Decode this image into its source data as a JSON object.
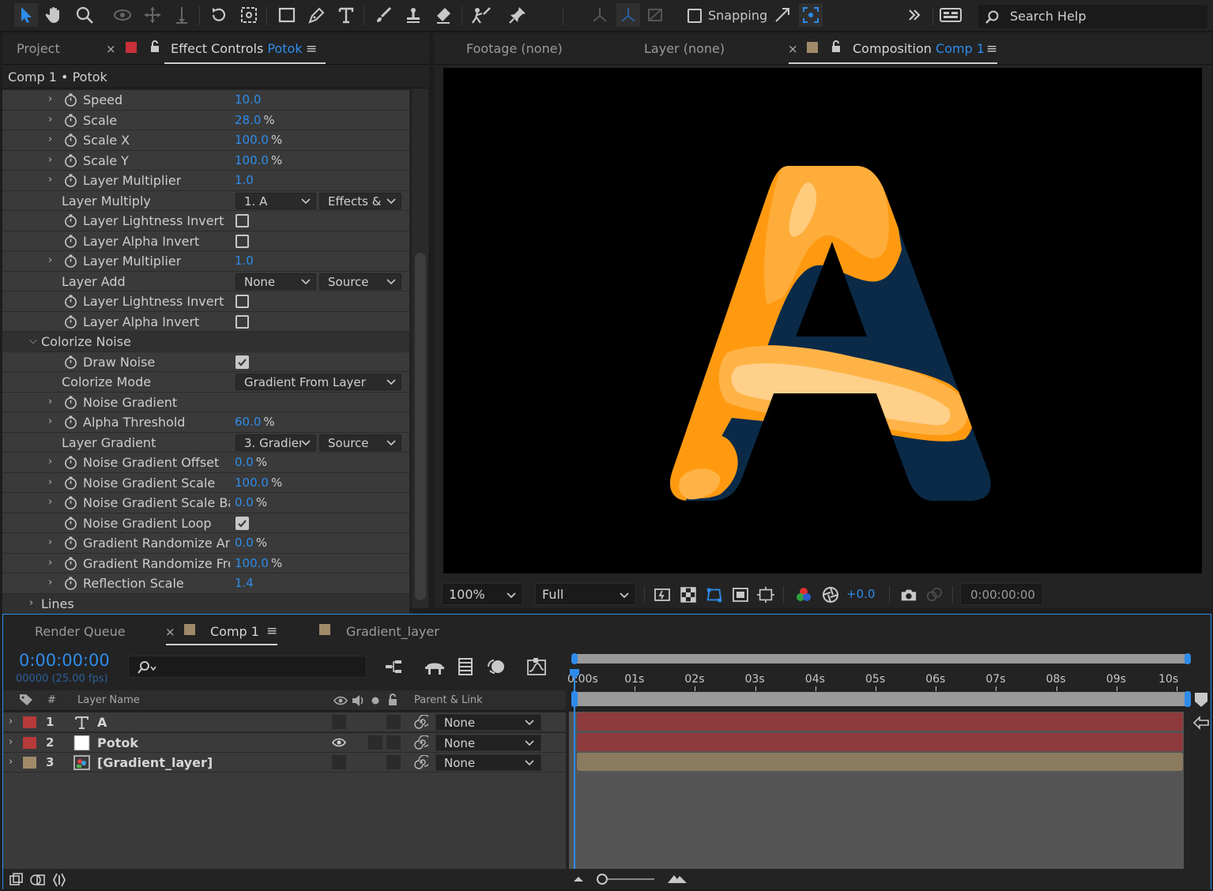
{
  "toolbar": {
    "snapping_label": "Snapping",
    "search_placeholder": "Search Help"
  },
  "left_panel": {
    "tabs": [
      {
        "label": "Project"
      },
      {
        "label": "Effect Controls",
        "target": "Potok"
      }
    ],
    "header": "Comp 1 • Potok",
    "rows": [
      {
        "name": "Speed",
        "value": "10.0",
        "unit": ""
      },
      {
        "name": "Scale",
        "value": "28.0",
        "unit": "%"
      },
      {
        "name": "Scale X",
        "value": "100.0",
        "unit": "%"
      },
      {
        "name": "Scale Y",
        "value": "100.0",
        "unit": "%"
      },
      {
        "name": "Layer Multiplier",
        "value": "1.0",
        "unit": ""
      },
      {
        "name": "Layer Multiply",
        "drop1": "1. A",
        "drop2": "Effects & I"
      },
      {
        "name": "Layer Lightness Invert",
        "checked": false
      },
      {
        "name": "Layer Alpha Invert",
        "checked": false
      },
      {
        "name": "Layer Multiplier",
        "value": "1.0",
        "unit": ""
      },
      {
        "name": "Layer Add",
        "drop1": "None",
        "drop2": "Source"
      },
      {
        "name": "Layer Lightness Invert",
        "checked": false
      },
      {
        "name": "Layer Alpha Invert",
        "checked": false
      },
      {
        "name": "Colorize Noise",
        "group": true,
        "expanded": true
      },
      {
        "name": "Draw Noise",
        "checked": true
      },
      {
        "name": "Colorize Mode",
        "drop_wide": "Gradient From Layer"
      },
      {
        "name": "Noise Gradient"
      },
      {
        "name": "Alpha Threshold",
        "value": "60.0",
        "unit": "%"
      },
      {
        "name": "Layer Gradient",
        "drop1": "3. Gradier",
        "drop2": "Source"
      },
      {
        "name": "Noise Gradient Offset",
        "value": "0.0",
        "unit": "%"
      },
      {
        "name": "Noise Gradient Scale",
        "value": "100.0",
        "unit": "%"
      },
      {
        "name": "Noise Gradient Scale Bas",
        "value": "0.0",
        "unit": "%"
      },
      {
        "name": "Noise Gradient Loop",
        "checked": true
      },
      {
        "name": "Gradient Randomize Am",
        "value": "0.0",
        "unit": "%"
      },
      {
        "name": "Gradient Randomize Fre",
        "value": "100.0",
        "unit": "%"
      },
      {
        "name": "Reflection Scale",
        "value": "1.4",
        "unit": ""
      },
      {
        "name": "Lines",
        "group": true,
        "expanded": false
      }
    ]
  },
  "comp_panel": {
    "tabs": [
      {
        "label": "Footage",
        "value": "(none)"
      },
      {
        "label": "Layer",
        "value": "(none)"
      },
      {
        "label": "Composition",
        "target": "Comp 1"
      }
    ],
    "zoom": "100%",
    "resolution": "Full",
    "exposure": "+0.0",
    "timecode": "0:00:00:00"
  },
  "timeline": {
    "tabs": [
      {
        "label": "Render Queue"
      },
      {
        "label": "Comp 1"
      },
      {
        "label": "Gradient_layer"
      }
    ],
    "current_time": "0:00:00:00",
    "frames": "00000 (25.00 fps)",
    "columns": {
      "num": "#",
      "layer_name": "Layer Name",
      "parent": "Parent & Link"
    },
    "ruler": [
      "0:00s",
      "01s",
      "02s",
      "03s",
      "04s",
      "05s",
      "06s",
      "07s",
      "08s",
      "09s",
      "10s"
    ],
    "layers": [
      {
        "num": "1",
        "name": "A",
        "type": "text",
        "label_color": "#b53a3a",
        "parent": "None",
        "bar_color": "#8f3a3c"
      },
      {
        "num": "2",
        "name": "Potok",
        "type": "solid",
        "label_color": "#b53a3a",
        "parent": "None",
        "bar_color": "#8f3a3c",
        "visible": true
      },
      {
        "num": "3",
        "name": "[Gradient_layer]",
        "type": "comp",
        "label_color": "#a08a6a",
        "parent": "None",
        "bar_color": "#8a7a5e"
      }
    ]
  },
  "colors": {
    "accent": "#2d8ceb",
    "letter_orange": "#ff9a10",
    "letter_navy": "#0a2a48"
  }
}
